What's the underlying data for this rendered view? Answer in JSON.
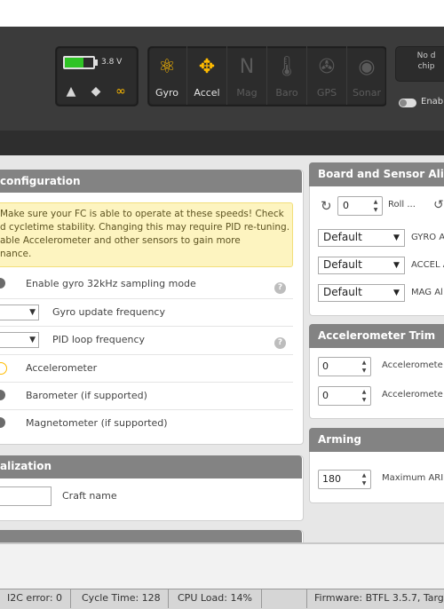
{
  "header": {
    "battery": {
      "voltage": "3.8 V",
      "level_fraction": 0.65
    },
    "status_icons": [
      {
        "name": "warning-icon",
        "glyph": "▲"
      },
      {
        "name": "diamond-icon",
        "glyph": "◆"
      },
      {
        "name": "link-icon",
        "glyph": "∞"
      }
    ],
    "sensors": [
      {
        "label": "Gyro",
        "glyph": "⚛",
        "active": true
      },
      {
        "label": "Accel",
        "glyph": "✥",
        "active": true
      },
      {
        "label": "Mag",
        "glyph": "N",
        "active": false
      },
      {
        "label": "Baro",
        "glyph": "🌡",
        "active": false
      },
      {
        "label": "GPS",
        "glyph": "✇",
        "active": false
      },
      {
        "label": "Sonar",
        "glyph": "◉",
        "active": false
      }
    ],
    "dataflash_line1": "No d",
    "dataflash_line2": "chip",
    "expert_toggle_label": "Enab"
  },
  "system_config": {
    "title": "configuration",
    "warning_lines": [
      "Make sure your FC is able to operate at these speeds! Check",
      "d cycletime stability. Changing this may require PID re-tuning.",
      "able Accelerometer and other sensors to gain more",
      "nance."
    ],
    "gyro32k_label": "Enable gyro 32kHz sampling mode",
    "gyro_update_label": "Gyro update frequency",
    "pid_loop_label": "PID loop frequency",
    "accelerometer_label": "Accelerometer",
    "barometer_label": "Barometer (if supported)",
    "magnetometer_label": "Magnetometer (if supported)",
    "help_glyph": "?"
  },
  "personalization": {
    "title": "alization",
    "craft_name_label": "Craft name",
    "craft_name_value": ""
  },
  "board_alignment": {
    "title": "Board and Sensor Aligi",
    "roll_value": "0",
    "roll_label": "Roll ...",
    "gyro_align": {
      "value": "Default",
      "label": "GYRO A"
    },
    "accel_align": {
      "value": "Default",
      "label": "ACCEL A"
    },
    "mag_align": {
      "value": "Default",
      "label": "MAG Al"
    }
  },
  "acc_trim": {
    "title": "Accelerometer Trim",
    "rows": [
      {
        "value": "0",
        "label": "Acceleromete"
      },
      {
        "value": "0",
        "label": "Acceleromete"
      }
    ]
  },
  "arming": {
    "title": "Arming",
    "max_angle_value": "180",
    "max_angle_label": "Maximum ARI"
  },
  "status_bar": {
    "i2c_error": "I2C error: 0",
    "cycle_time": "Cycle Time: 128",
    "cpu_load": "CPU Load: 14%",
    "firmware": "Firmware: BTFL 3.5.7, Targ"
  },
  "colors": {
    "header_bg": "#3b3b3b",
    "accent_yellow": "#ffbb00",
    "panel_header": "#838383",
    "battery_green": "#2fc425",
    "warning_bg": "#fdf4c0"
  }
}
